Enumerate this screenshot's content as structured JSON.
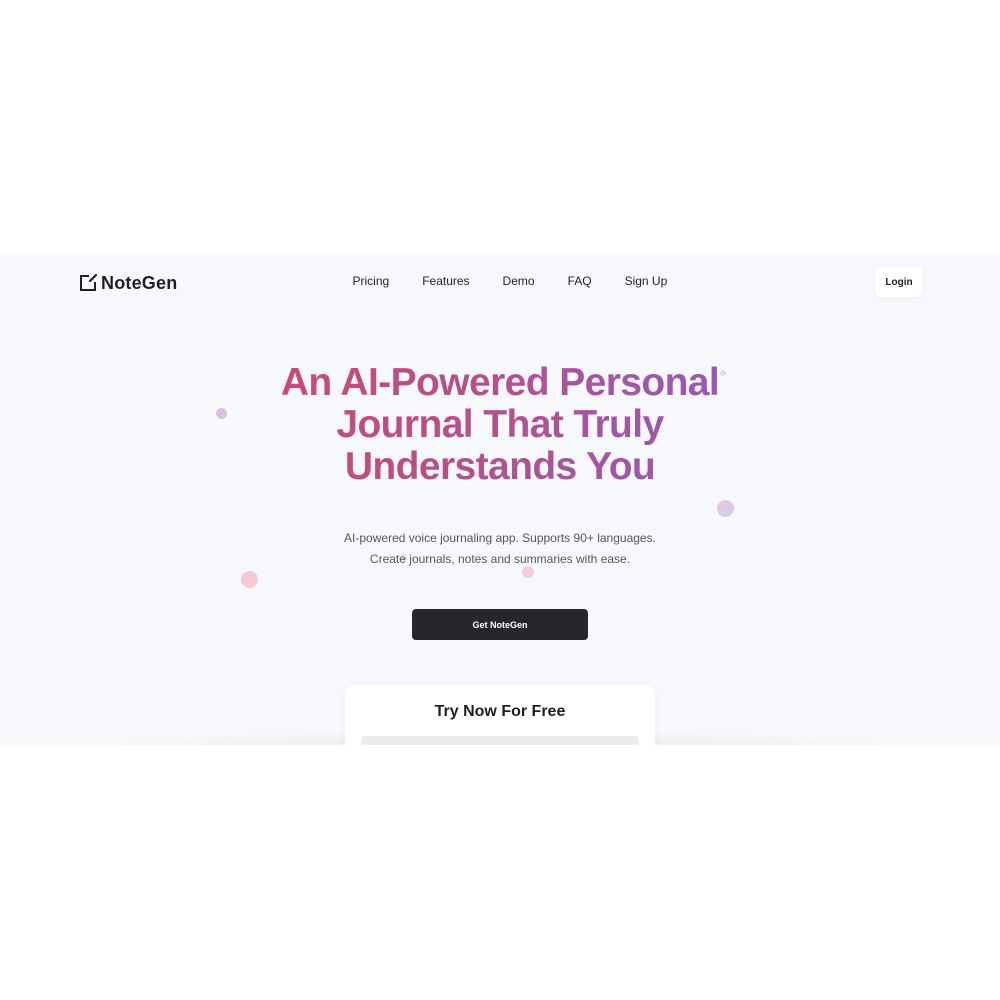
{
  "brand": {
    "name": "NoteGen",
    "icon": "note-edit-icon"
  },
  "nav": {
    "links": [
      "Pricing",
      "Features",
      "Demo",
      "FAQ",
      "Sign Up"
    ],
    "login_label": "Login"
  },
  "hero": {
    "title_line1": "An AI-Powered Personal",
    "title_line2": "Journal That Truly",
    "title_line3": "Understands You",
    "subtitle_line1": "AI-powered voice journaling app. Supports 90+ languages.",
    "subtitle_line2": "Create journals, notes and summaries with ease.",
    "cta_label": "Get NoteGen"
  },
  "try_card": {
    "title": "Try Now For Free"
  },
  "colors": {
    "page_bg": "#f7f8fc",
    "text_dark": "#1f2024",
    "cta_bg": "#26272b",
    "gradient_start": "#cf4a6a",
    "gradient_end": "#8e5cc2"
  }
}
